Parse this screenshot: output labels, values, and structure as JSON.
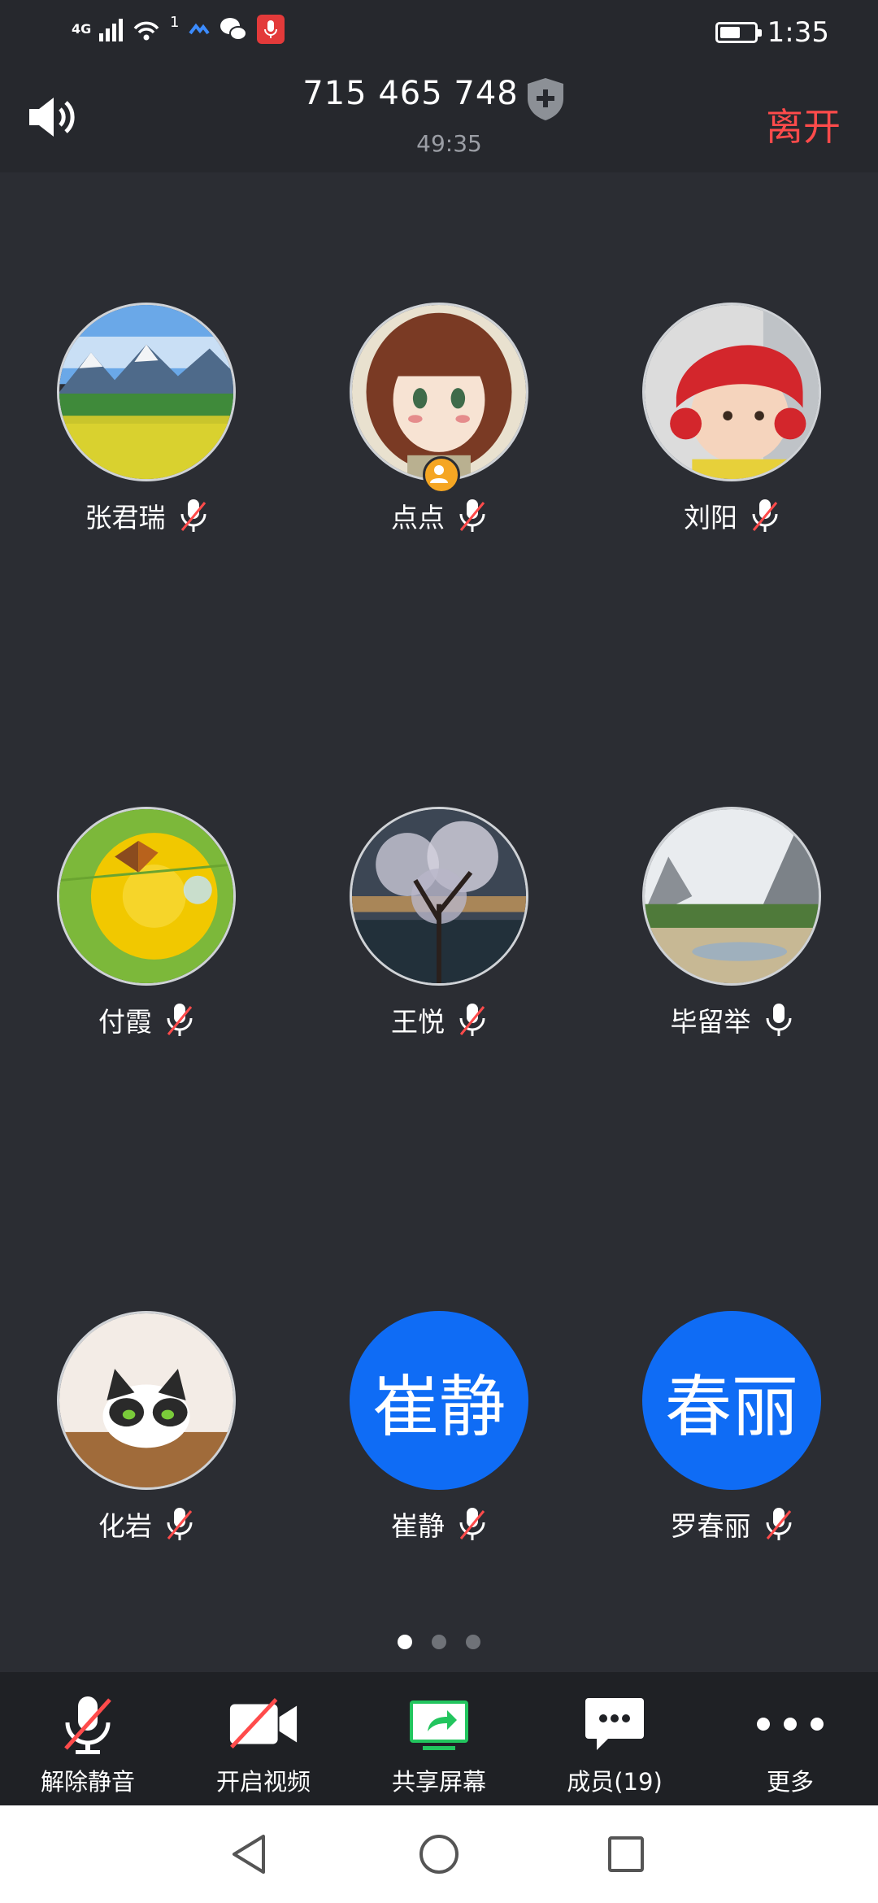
{
  "status_bar": {
    "network": "4G",
    "wifi_badge": "1",
    "time": "1:35",
    "battery_level": 0.6,
    "icons": [
      "signal-icon",
      "wifi-icon",
      "app-notification-icon",
      "wechat-icon",
      "recording-mic-icon",
      "battery-icon"
    ]
  },
  "header": {
    "meeting_id": "715 465 748",
    "timer": "49:35",
    "leave_label": "离开",
    "leave_color": "#ff4b4b"
  },
  "participants": [
    {
      "name": "张君瑞",
      "avatar": "landscape-field",
      "muted": true
    },
    {
      "name": "点点",
      "avatar": "cartoon-girl",
      "muted": true,
      "host": true
    },
    {
      "name": "刘阳",
      "avatar": "child-red-hat",
      "muted": true
    },
    {
      "name": "付霞",
      "avatar": "butterfly-dandelion",
      "muted": true
    },
    {
      "name": "王悦",
      "avatar": "cherry-tree",
      "muted": true
    },
    {
      "name": "毕留举",
      "avatar": "mountain-painting",
      "muted": false
    },
    {
      "name": "化岩",
      "avatar": "cat",
      "muted": true
    },
    {
      "name": "崔静",
      "avatar_text": "崔静",
      "muted": true
    },
    {
      "name": "罗春丽",
      "avatar_text": "春丽",
      "muted": true
    }
  ],
  "pagination": {
    "pages": 3,
    "current": 1
  },
  "toolbar": {
    "unmute": "解除静音",
    "start_video": "开启视频",
    "share_screen": "共享屏幕",
    "members": "成员(19)",
    "more": "更多"
  },
  "colors": {
    "background": "#2b2d33",
    "avatar_blue": "#0f6cf5",
    "share_green": "#22c55e",
    "mute_slash": "#ff4b4b"
  }
}
